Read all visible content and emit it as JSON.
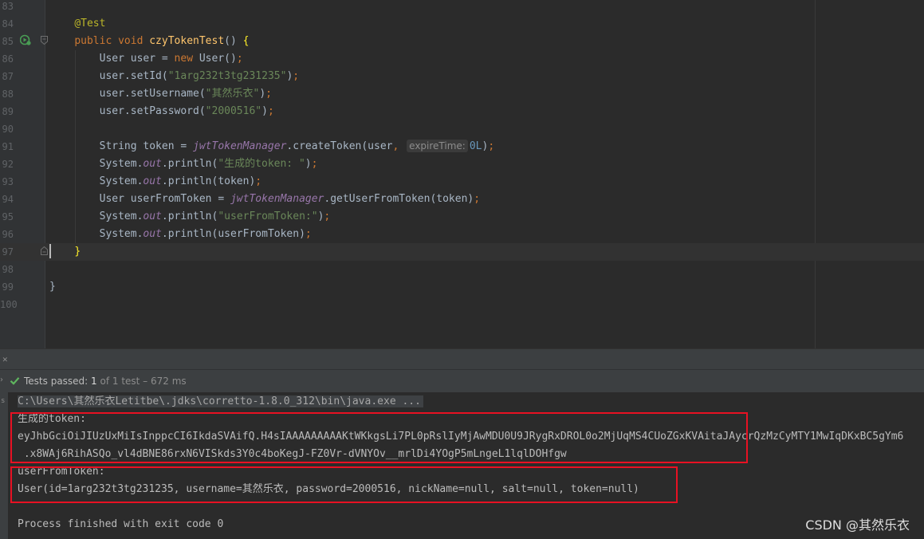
{
  "editor": {
    "lines": [
      {
        "n": "83",
        "parts": []
      },
      {
        "n": "84",
        "parts": [
          {
            "t": "    "
          },
          {
            "t": "@Test",
            "c": "ann"
          }
        ]
      },
      {
        "n": "85",
        "parts": [
          {
            "t": "    "
          },
          {
            "t": "public void ",
            "c": "kw"
          },
          {
            "t": "czyTokenTest",
            "c": "fn"
          },
          {
            "t": "() "
          },
          {
            "t": "{",
            "c": "brace-hl"
          }
        ]
      },
      {
        "n": "86",
        "parts": [
          {
            "t": "        User user = "
          },
          {
            "t": "new ",
            "c": "kw"
          },
          {
            "t": "User()"
          },
          {
            "t": ";",
            "c": "kw"
          }
        ]
      },
      {
        "n": "87",
        "parts": [
          {
            "t": "        user.setId("
          },
          {
            "t": "\"1arg232t3tg231235\"",
            "c": "str"
          },
          {
            "t": ")"
          },
          {
            "t": ";",
            "c": "kw"
          }
        ]
      },
      {
        "n": "88",
        "parts": [
          {
            "t": "        user.setUsername("
          },
          {
            "t": "\"其然乐衣\"",
            "c": "str"
          },
          {
            "t": ")"
          },
          {
            "t": ";",
            "c": "kw"
          }
        ]
      },
      {
        "n": "89",
        "parts": [
          {
            "t": "        user.setPassword("
          },
          {
            "t": "\"2000516\"",
            "c": "str"
          },
          {
            "t": ")"
          },
          {
            "t": ";",
            "c": "kw"
          }
        ]
      },
      {
        "n": "90",
        "parts": []
      },
      {
        "n": "91",
        "parts": [
          {
            "t": "        String token = "
          },
          {
            "t": "jwtTokenManager",
            "c": "fld"
          },
          {
            "t": ".createToken(user"
          },
          {
            "t": ", ",
            "c": "kw"
          },
          {
            "t": "expireTime:",
            "c": "hint"
          },
          {
            "t": "0L",
            "c": "num"
          },
          {
            "t": ")"
          },
          {
            "t": ";",
            "c": "kw"
          }
        ]
      },
      {
        "n": "92",
        "parts": [
          {
            "t": "        System."
          },
          {
            "t": "out",
            "c": "fld"
          },
          {
            "t": ".println("
          },
          {
            "t": "\"生成的token: \"",
            "c": "str"
          },
          {
            "t": ")"
          },
          {
            "t": ";",
            "c": "kw"
          }
        ]
      },
      {
        "n": "93",
        "parts": [
          {
            "t": "        System."
          },
          {
            "t": "out",
            "c": "fld"
          },
          {
            "t": ".println(token)"
          },
          {
            "t": ";",
            "c": "kw"
          }
        ]
      },
      {
        "n": "94",
        "parts": [
          {
            "t": "        User userFromToken = "
          },
          {
            "t": "jwtTokenManager",
            "c": "fld"
          },
          {
            "t": ".getUserFromToken(token)"
          },
          {
            "t": ";",
            "c": "kw"
          }
        ]
      },
      {
        "n": "95",
        "parts": [
          {
            "t": "        System."
          },
          {
            "t": "out",
            "c": "fld"
          },
          {
            "t": ".println("
          },
          {
            "t": "\"userFromToken:\"",
            "c": "str"
          },
          {
            "t": ")"
          },
          {
            "t": ";",
            "c": "kw"
          }
        ]
      },
      {
        "n": "96",
        "parts": [
          {
            "t": "        System."
          },
          {
            "t": "out",
            "c": "fld"
          },
          {
            "t": ".println(userFromToken)"
          },
          {
            "t": ";",
            "c": "kw"
          }
        ]
      },
      {
        "n": "97",
        "parts": [
          {
            "t": "    "
          },
          {
            "t": "}",
            "c": "brace-hl"
          }
        ],
        "current": true
      },
      {
        "n": "98",
        "parts": []
      },
      {
        "n": "99",
        "parts": [
          {
            "t": "}"
          }
        ]
      },
      {
        "n": "100",
        "parts": []
      }
    ]
  },
  "run": {
    "status_prefix": "Tests passed: ",
    "passed_count": "1",
    "status_suffix": " of 1 test – 672 ms"
  },
  "console": {
    "command": "C:\\Users\\其然乐衣Letitbe\\.jdks\\corretto-1.8.0_312\\bin\\java.exe ...",
    "token_label": "生成的token:",
    "token_line1": "eyJhbGciOiJIUzUxMiIsInppcCI6IkdaSVAifQ.H4sIAAAAAAAAAKtWKkgsLi7PL0pRslIyMjAwMDU0U9JRygRxDROL0o2MjUqMS4CUoZGxKVAitaJAycrQzMzCyMTY1MwIqDKxBC5gYm6",
    "token_line2": " .x8WAj6RihASQo_vl4dBNE86rxN6VISkds3Y0c4boKegJ-FZ0Vr-dVNYOv__mrlDi4YOgP5mLngeL1lqlDOHfgw",
    "user_label": "userFromToken:",
    "user_value": "User(id=1arg232t3tg231235, username=其然乐衣, password=2000516, nickName=null, salt=null, token=null)",
    "exit_message": "Process finished with exit code 0"
  },
  "watermark": "CSDN @其然乐衣"
}
